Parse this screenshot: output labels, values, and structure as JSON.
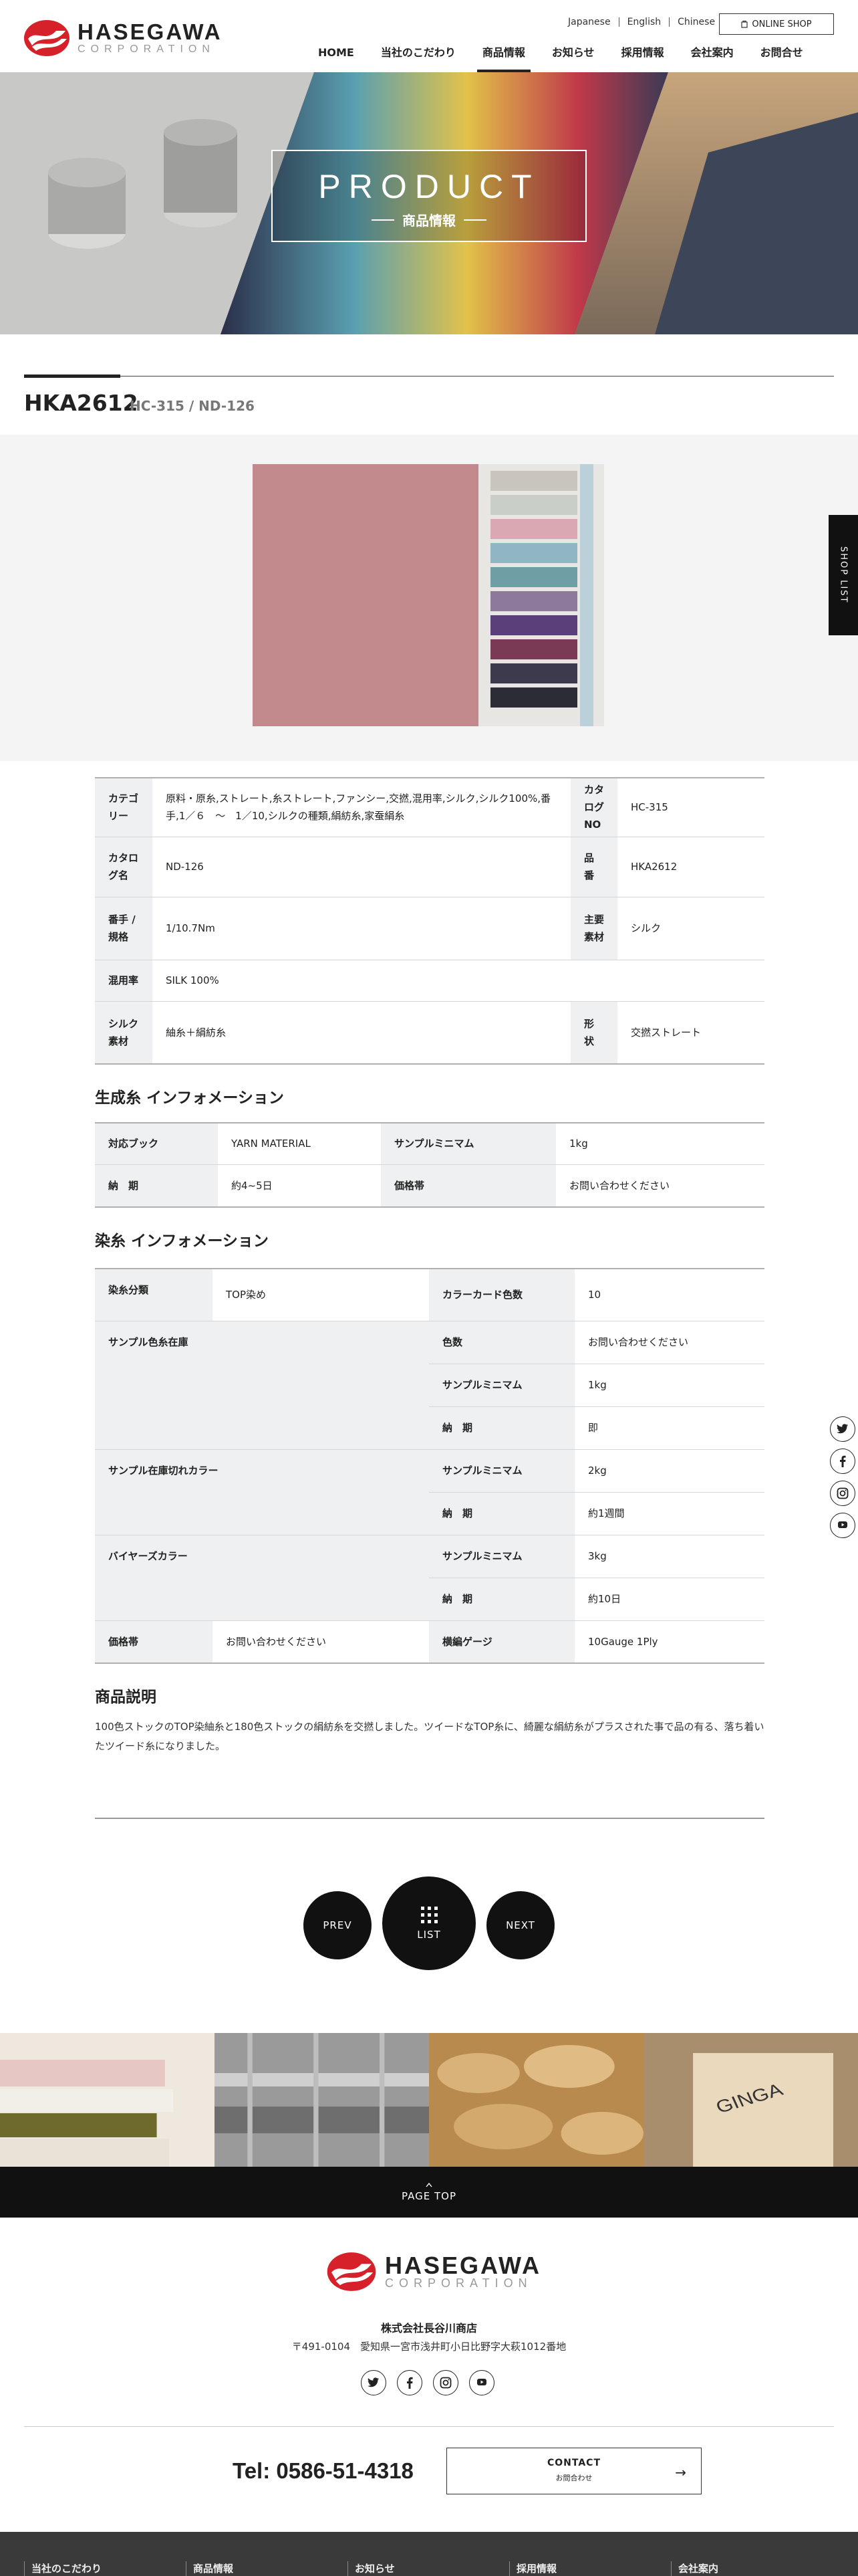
{
  "header": {
    "logo_name": "HASEGAWA",
    "logo_sub": "CORPORATION",
    "languages": [
      "Japanese",
      "English",
      "Chinese"
    ],
    "shop_button": "ONLINE SHOP",
    "nav": [
      "HOME",
      "当社のこだわり",
      "商品情報",
      "お知らせ",
      "採用情報",
      "会社案内",
      "お問合せ"
    ],
    "nav_active": "商品情報"
  },
  "hero": {
    "title": "PRODUCT",
    "subtitle": "商品情報"
  },
  "product": {
    "code": "HKA2612",
    "sub_codes": "HC-315 / ND-126"
  },
  "side": {
    "shop_list": "SHOP LIST"
  },
  "spec": {
    "category_label": "カテゴリー",
    "category_value": "原料・原糸,ストレート,糸ストレート,ファンシー,交撚,混用率,シルク,シルク100%,番手,1／６　～　1／10,シルクの種類,絹紡糸,家蚕絹糸",
    "catalog_no_label": "カタログNO",
    "catalog_no_value": "HC-315",
    "catalog_name_label": "カタログ名",
    "catalog_name_value": "ND-126",
    "item_no_label": "品　番",
    "item_no_value": "HKA2612",
    "count_label": "番手 / 規格",
    "count_value": "1/10.7Nm",
    "material_label": "主要素材",
    "material_value": "シルク",
    "blend_label": "混用率",
    "blend_value": "SILK 100%",
    "silk_label": "シルク素材",
    "silk_value": "紬糸＋絹紡糸",
    "shape_label": "形　状",
    "shape_value": "交撚ストレート"
  },
  "raw_info": {
    "heading": "生成糸 インフォメーション",
    "book_label": "対応ブック",
    "book_value": "YARN MATERIAL",
    "min_label": "サンプルミニマム",
    "min_value": "1kg",
    "lead_label": "納　期",
    "lead_value": "約4~5日",
    "price_label": "価格帯",
    "price_value": "お問い合わせください"
  },
  "dye_info": {
    "heading": "染糸 インフォメーション",
    "dye_type_label": "染糸分類",
    "dye_type_value": "TOP染め",
    "colorcard_label": "カラーカード色数",
    "colorcard_value": "10",
    "stock_label": "サンプル色糸在庫",
    "stock_colors_label": "色数",
    "stock_colors_value": "お問い合わせください",
    "stock_min_label": "サンプルミニマム",
    "stock_min_value": "1kg",
    "stock_lead_label": "納　期",
    "stock_lead_value": "即",
    "oos_label": "サンプル在庫切れカラー",
    "oos_min_label": "サンプルミニマム",
    "oos_min_value": "2kg",
    "oos_lead_label": "納　期",
    "oos_lead_value": "約1週間",
    "buyer_label": "バイヤーズカラー",
    "buyer_min_label": "サンプルミニマム",
    "buyer_min_value": "3kg",
    "buyer_lead_label": "納　期",
    "buyer_lead_value": "約10日",
    "price_label": "価格帯",
    "price_value": "お問い合わせください",
    "gauge_label": "横編ゲージ",
    "gauge_value": "10Gauge 1Ply"
  },
  "description": {
    "heading": "商品説明",
    "text": "100色ストックのTOP染紬糸と180色ストックの絹紡糸を交撚しました。ツイードなTOP糸に、綺麗な絹紡糸がプラスされた事で品の有る、落ち着いたツイード糸になりました。"
  },
  "pager": {
    "prev": "PREV",
    "list": "LIST",
    "next": "NEXT"
  },
  "pagetop": "PAGE TOP",
  "footer": {
    "company": "株式会社長谷川商店",
    "address": "〒491-0104　愛知県一宮市浅井町小日比野字大萩1012番地",
    "tel": "Tel: 0586-51-4318",
    "contact_en": "CONTACT",
    "contact_ja": "お問合わせ",
    "bottom_cols": [
      "当社のこだわり",
      "商品情報",
      "お知らせ",
      "採用情報",
      "会社案内"
    ]
  },
  "colors": {
    "brand_red": "#d6202a",
    "dark": "#111111",
    "table_header_bg": "#eef0f1",
    "fabric_pink": "#c98f93"
  }
}
